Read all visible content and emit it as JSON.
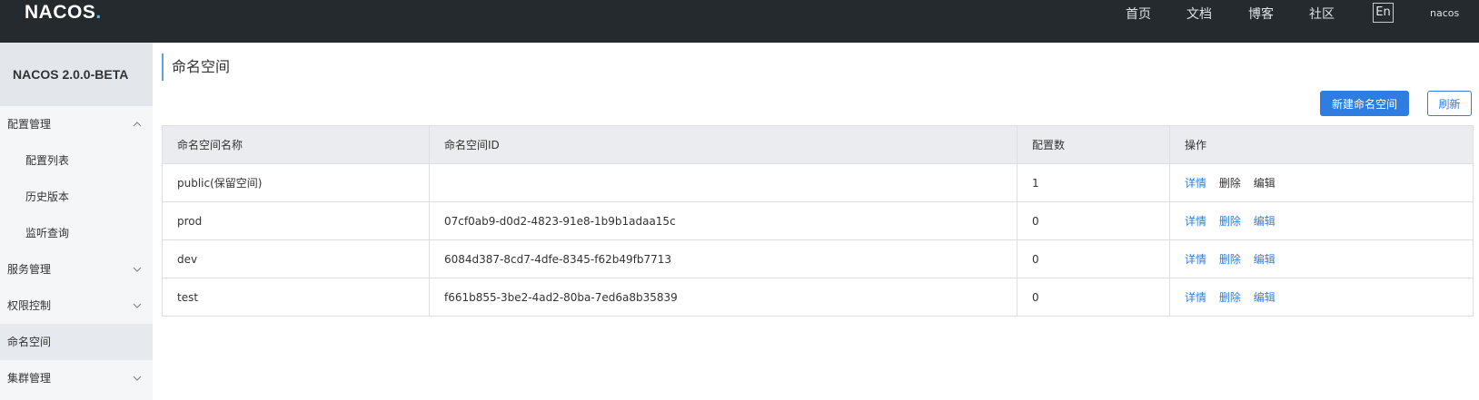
{
  "header": {
    "logo_text_1": "NA",
    "logo_text_2": "C",
    "logo_text_3": "OS",
    "logo_dot": ".",
    "nav": [
      "首页",
      "文档",
      "博客",
      "社区"
    ],
    "lang_button": "En",
    "user": "nacos"
  },
  "sidebar": {
    "title": "NACOS 2.0.0-BETA",
    "items": [
      {
        "label": "配置管理",
        "level": 1,
        "chevron": "up"
      },
      {
        "label": "配置列表",
        "level": 2
      },
      {
        "label": "历史版本",
        "level": 2
      },
      {
        "label": "监听查询",
        "level": 2
      },
      {
        "label": "服务管理",
        "level": 1,
        "chevron": "down"
      },
      {
        "label": "权限控制",
        "level": 1,
        "chevron": "down"
      },
      {
        "label": "命名空间",
        "level": 1,
        "active": true
      },
      {
        "label": "集群管理",
        "level": 1,
        "chevron": "down"
      }
    ]
  },
  "main": {
    "title": "命名空间",
    "new_button": "新建命名空间",
    "refresh_button": "刷新",
    "table": {
      "columns": [
        "命名空间名称",
        "命名空间ID",
        "配置数",
        "操作"
      ],
      "rows": [
        {
          "name": "public(保留空间)",
          "id": "",
          "count": "1",
          "ops": [
            {
              "label": "详情",
              "link": true
            },
            {
              "label": "删除",
              "link": false
            },
            {
              "label": "编辑",
              "link": false
            }
          ]
        },
        {
          "name": "prod",
          "id": "07cf0ab9-d0d2-4823-91e8-1b9b1adaa15c",
          "count": "0",
          "ops": [
            {
              "label": "详情",
              "link": true
            },
            {
              "label": "删除",
              "link": true
            },
            {
              "label": "编辑",
              "link": true
            }
          ]
        },
        {
          "name": "dev",
          "id": "6084d387-8cd7-4dfe-8345-f62b49fb7713",
          "count": "0",
          "ops": [
            {
              "label": "详情",
              "link": true
            },
            {
              "label": "删除",
              "link": true
            },
            {
              "label": "编辑",
              "link": true
            }
          ]
        },
        {
          "name": "test",
          "id": "f661b855-3be2-4ad2-80ba-7ed6a8b35839",
          "count": "0",
          "ops": [
            {
              "label": "详情",
              "link": true
            },
            {
              "label": "删除",
              "link": true
            },
            {
              "label": "编辑",
              "link": true
            }
          ]
        }
      ]
    }
  },
  "colors": {
    "primary": "#2f7de1",
    "header_bg": "#252a2f",
    "logo_accent": "#3ec5ff"
  }
}
